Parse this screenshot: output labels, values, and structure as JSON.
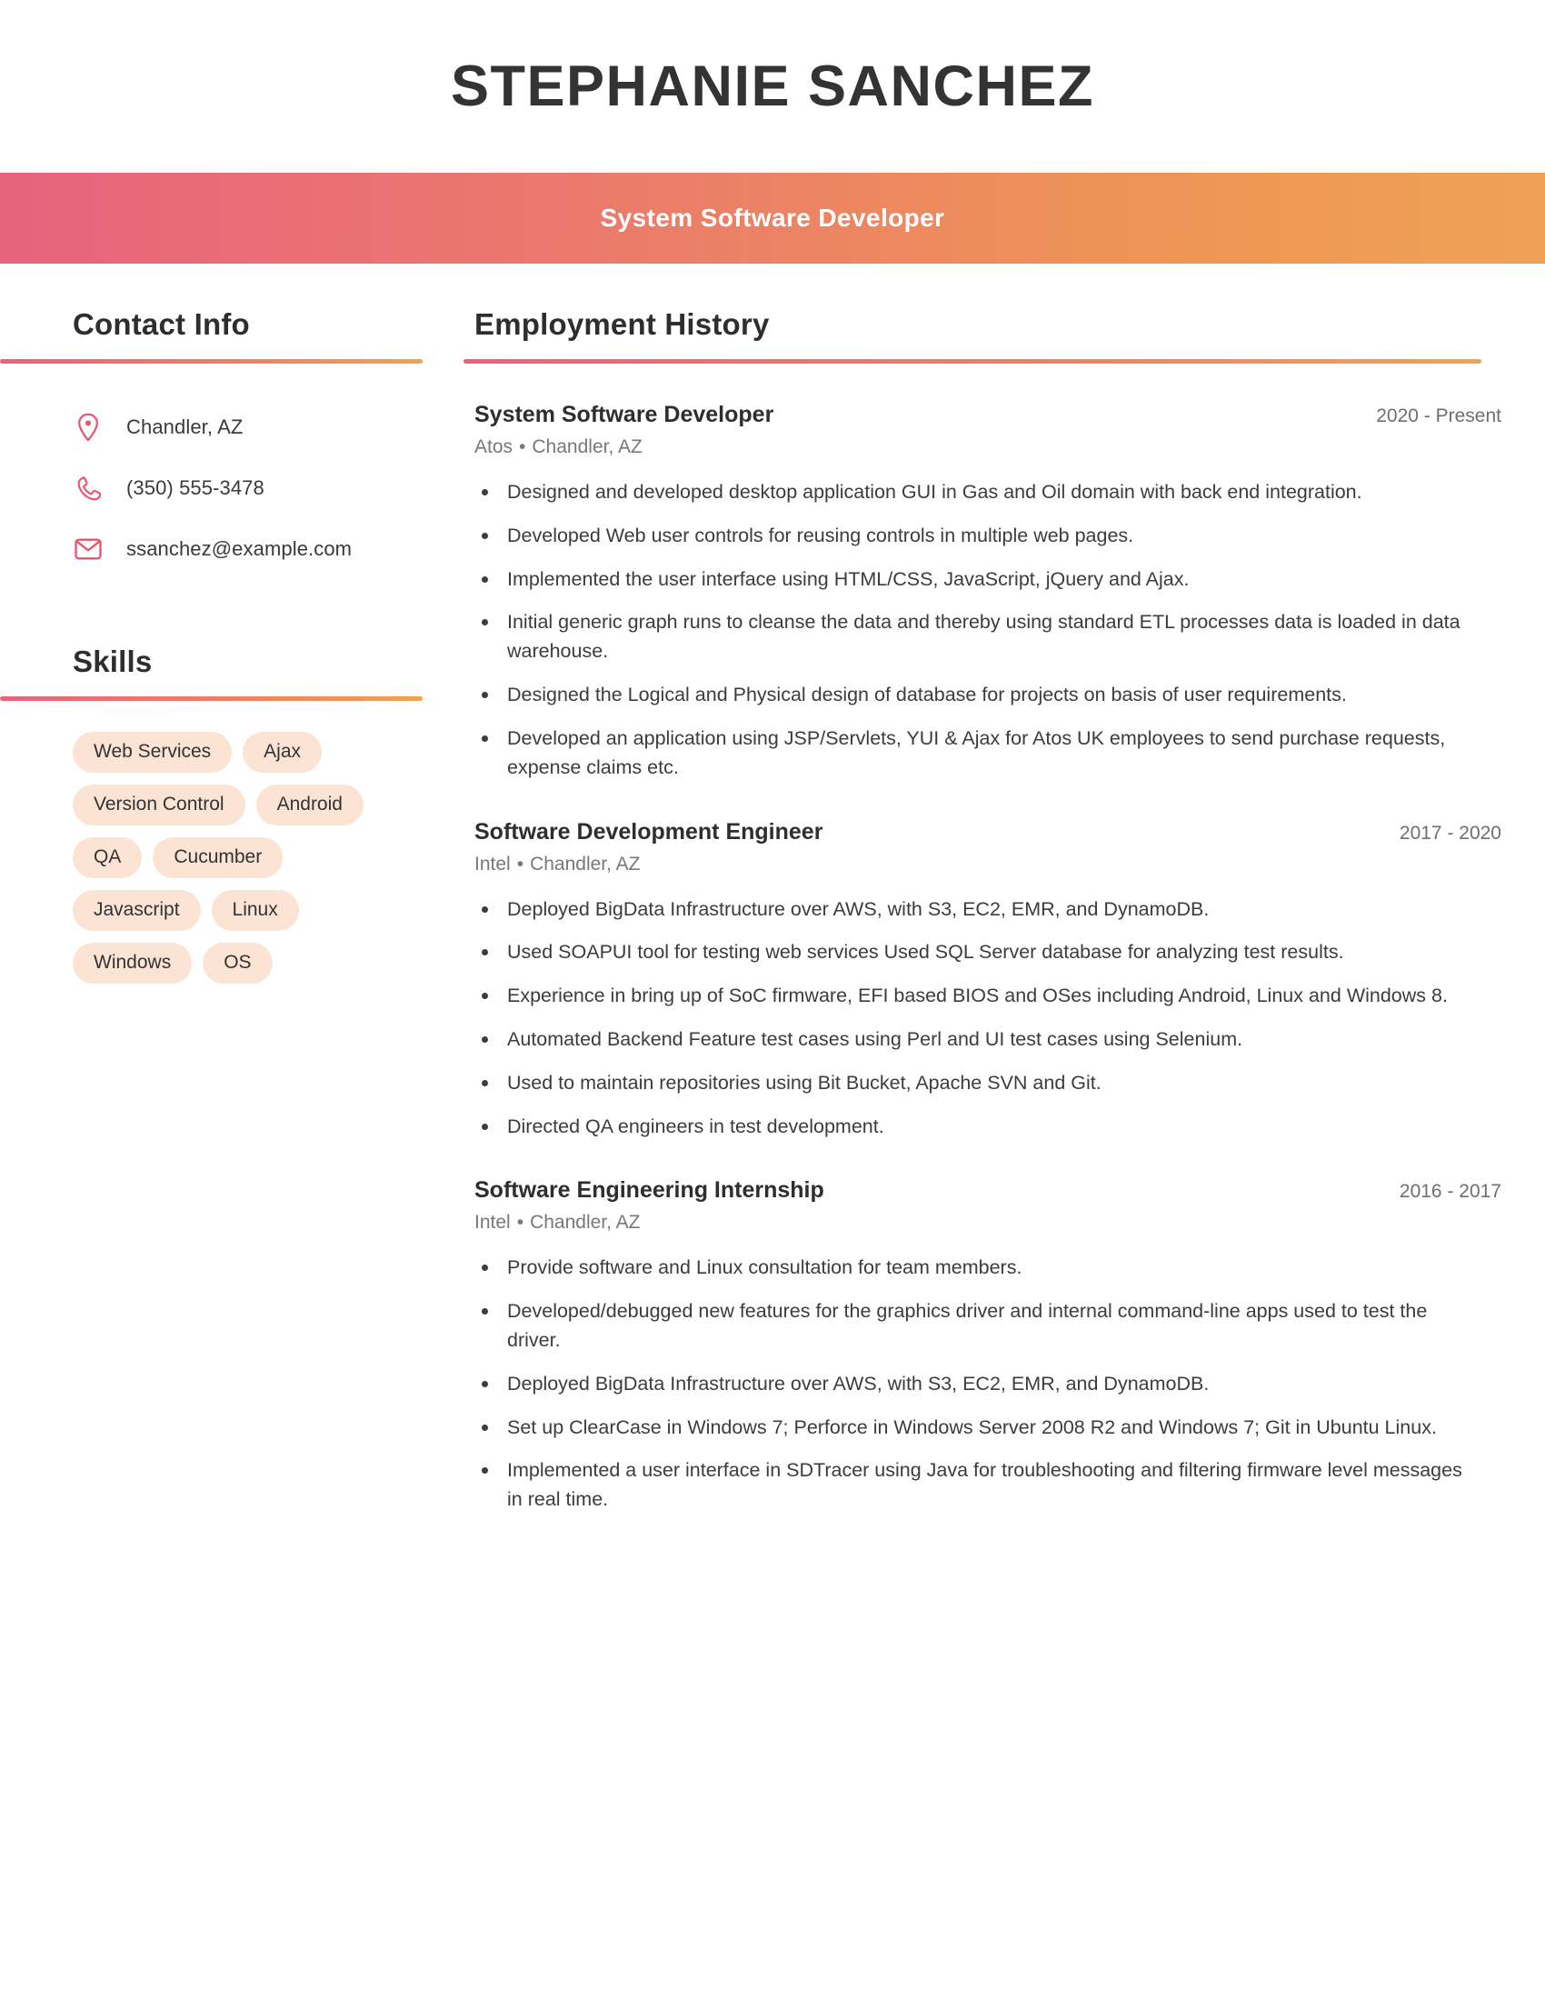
{
  "theme": {
    "gradient_start": "#E8637D",
    "gradient_end": "#EFA255",
    "chip_background": "#FBE4D4",
    "icon_color": "#E8566F",
    "text_primary": "#333333",
    "text_muted": "#787878"
  },
  "header": {
    "full_name": "STEPHANIE SANCHEZ",
    "job_title": "System Software Developer"
  },
  "sidebar": {
    "contact": {
      "heading": "Contact Info",
      "items": [
        {
          "icon": "location-pin-icon",
          "value": "Chandler, AZ"
        },
        {
          "icon": "phone-icon",
          "value": "(350) 555-3478"
        },
        {
          "icon": "envelope-icon",
          "value": "ssanchez@example.com"
        }
      ]
    },
    "skills": {
      "heading": "Skills",
      "items": [
        "Web Services",
        "Ajax",
        "Version Control",
        "Android",
        "QA",
        "Cucumber",
        "Javascript",
        "Linux",
        "Windows",
        "OS"
      ]
    }
  },
  "main": {
    "employment": {
      "heading": "Employment History",
      "jobs": [
        {
          "role": "System Software Developer",
          "dates": "2020 - Present",
          "company": "Atos",
          "location": "Chandler, AZ",
          "separator": "•",
          "bullets": [
            "Designed and developed desktop application GUI in Gas and Oil domain with back end integration.",
            "Developed Web user controls for reusing controls in multiple web pages.",
            "Implemented the user interface using HTML/CSS, JavaScript, jQuery and Ajax.",
            "Initial generic graph runs to cleanse the data and thereby using standard ETL processes data is loaded in data warehouse.",
            "Designed the Logical and Physical design of database for projects on basis of user requirements.",
            "Developed an application using JSP/Servlets, YUI & Ajax for Atos UK employees to send purchase requests, expense claims etc."
          ]
        },
        {
          "role": "Software Development Engineer",
          "dates": "2017 - 2020",
          "company": "Intel",
          "location": "Chandler, AZ",
          "separator": "•",
          "bullets": [
            "Deployed BigData Infrastructure over AWS, with S3, EC2, EMR, and DynamoDB.",
            "Used SOAPUI tool for testing web services Used SQL Server database for analyzing test results.",
            "Experience in bring up of SoC firmware, EFI based BIOS and OSes including Android, Linux and Windows 8.",
            "Automated Backend Feature test cases using Perl and UI test cases using Selenium.",
            "Used to maintain repositories using Bit Bucket, Apache SVN and Git.",
            "Directed QA engineers in test development."
          ]
        },
        {
          "role": "Software Engineering Internship",
          "dates": "2016 - 2017",
          "company": "Intel",
          "location": "Chandler, AZ",
          "separator": "•",
          "bullets": [
            "Provide software and Linux consultation for team members.",
            "Developed/debugged new features for the graphics driver and internal command-line apps used to test the driver.",
            "Deployed BigData Infrastructure over AWS, with S3, EC2, EMR, and DynamoDB.",
            "Set up ClearCase in Windows 7; Perforce in Windows Server 2008 R2 and Windows 7; Git in Ubuntu Linux.",
            "Implemented a user interface in SDTracer using Java for troubleshooting and filtering firmware level messages in real time."
          ]
        }
      ]
    }
  }
}
